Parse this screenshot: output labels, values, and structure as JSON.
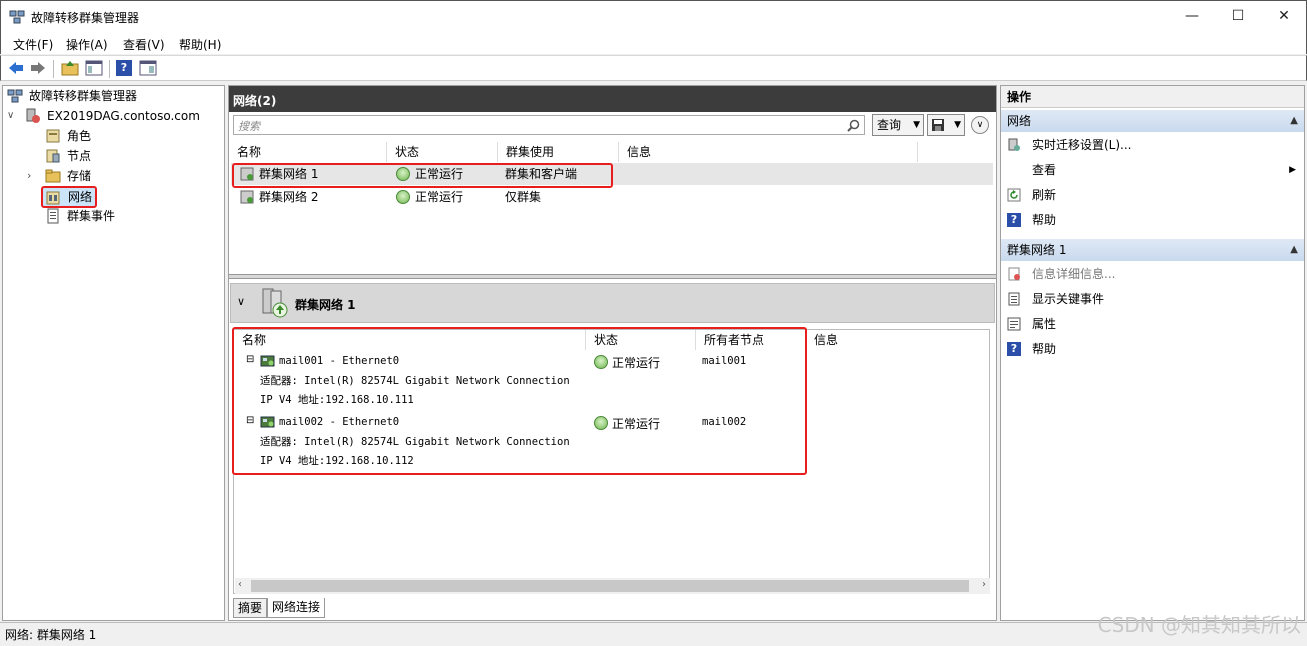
{
  "window": {
    "title": "故障转移群集管理器",
    "controls": [
      "minimize-icon",
      "maximize-icon",
      "close-icon"
    ]
  },
  "menu": [
    "文件(F)",
    "操作(A)",
    "查看(V)",
    "帮助(H)"
  ],
  "tree": {
    "root": "故障转移群集管理器",
    "cluster": "EX2019DAG.contoso.com",
    "items": [
      "角色",
      "节点",
      "存储",
      "网络",
      "群集事件"
    ],
    "selected": "网络"
  },
  "center": {
    "header": "网络(2)",
    "search_placeholder": "搜索",
    "query_label": "查询",
    "columns": [
      "名称",
      "状态",
      "群集使用",
      "信息"
    ],
    "rows": [
      {
        "name": "群集网络 1",
        "status": "正常运行",
        "usage": "群集和客户端",
        "info": ""
      },
      {
        "name": "群集网络 2",
        "status": "正常运行",
        "usage": "仅群集",
        "info": ""
      }
    ],
    "detail_title": "群集网络 1",
    "detail_columns": [
      "名称",
      "状态",
      "所有者节点",
      "信息"
    ],
    "detail_rows": [
      {
        "name": "mail001 - Ethernet0",
        "adapter": "适配器: Intel(R) 82574L Gigabit Network Connection",
        "ip": "IP V4 地址:192.168.10.111",
        "status": "正常运行",
        "owner": "mail001"
      },
      {
        "name": "mail002 - Ethernet0",
        "adapter": "适配器: Intel(R) 82574L Gigabit Network Connection",
        "ip": "IP V4 地址:192.168.10.112",
        "status": "正常运行",
        "owner": "mail002"
      }
    ],
    "tabs": [
      "摘要",
      "网络连接"
    ],
    "active_tab": "网络连接"
  },
  "actions": {
    "header": "操作",
    "section1": "网络",
    "section1_items": [
      "实时迁移设置(L)...",
      "查看",
      "刷新",
      "帮助"
    ],
    "section2": "群集网络 1",
    "section2_items": [
      "信息详细信息...",
      "显示关键事件",
      "属性",
      "帮助"
    ]
  },
  "statusbar": "网络: 群集网络 1",
  "watermark": "CSDN @知其知其所以"
}
